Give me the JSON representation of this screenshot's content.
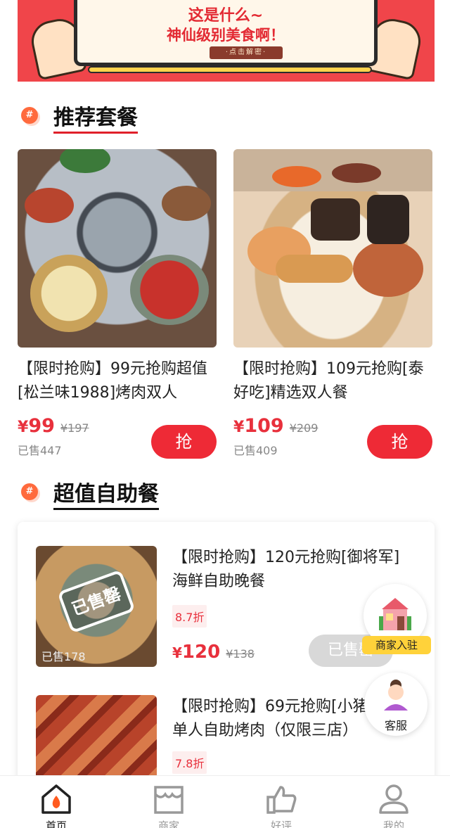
{
  "banner": {
    "line1": "这是什么~",
    "line2": "神仙级别美食啊！",
    "button": "·点击解密·"
  },
  "sections": {
    "recommended": {
      "icon": "hash-icon",
      "title": "推荐套餐",
      "hash": "#"
    },
    "buffet": {
      "icon": "hash-icon",
      "title": "超值自助餐",
      "hash": "#"
    }
  },
  "packages": [
    {
      "name": "【限时抢购】99元抢购超值[松兰味1988]烤肉双人",
      "currency": "¥",
      "price": "99",
      "original_price": "¥197",
      "sold": "已售447",
      "grab_label": "抢"
    },
    {
      "name": "【限时抢购】109元抢购[泰好吃]精选双人餐",
      "currency": "¥",
      "price": "109",
      "original_price": "¥209",
      "sold": "已售409",
      "grab_label": "抢"
    }
  ],
  "buffets": [
    {
      "name": "【限时抢购】120元抢购[御将军]海鲜自助晚餐",
      "discount": "8.7折",
      "currency": "¥",
      "price": "120",
      "original_price": "¥138",
      "sold": "已售178",
      "stamp": "已售罄",
      "status_button": "已售罄"
    },
    {
      "name": "【限时抢购】69元抢购[小猪料理]单人自助烤肉（仅限三店）",
      "discount": "7.8折"
    }
  ],
  "floating": {
    "merchant_label": "商家入驻",
    "service_label": "客服"
  },
  "tabbar": [
    {
      "label": "首页",
      "icon": "home-icon",
      "active": true
    },
    {
      "label": "商家",
      "icon": "store-icon",
      "active": false
    },
    {
      "label": "好评",
      "icon": "thumbs-up-icon",
      "active": false
    },
    {
      "label": "我的",
      "icon": "user-icon",
      "active": false
    }
  ],
  "colors": {
    "accent": "#ee2a36",
    "price": "#e8303c",
    "banner": "#f0454a",
    "label_yellow": "#ffd23a"
  }
}
